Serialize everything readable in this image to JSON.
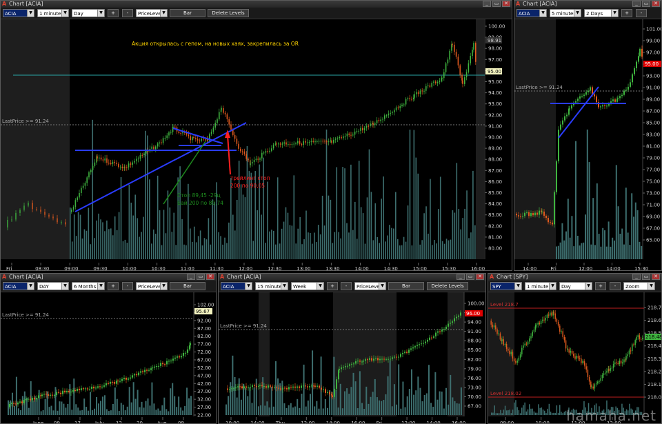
{
  "windows": {
    "w1": {
      "title": "Chart [ACIA]",
      "symbol": "ACIA",
      "interval": "1 minute",
      "range": "Day",
      "plus": "+",
      "minus": "-",
      "pricelevel": "PriceLeve",
      "bar_btn": "Bar",
      "delete_btn": "Delete Levels",
      "lastprice": "LastPrice >= 91.24",
      "yticks": [
        "100.00",
        "99.00",
        "98.00",
        "97.00",
        "96.00",
        "95.00",
        "94.00",
        "93.00",
        "92.00",
        "91.00",
        "90.00",
        "89.00",
        "88.00",
        "87.00",
        "86.00",
        "85.00",
        "84.00",
        "83.00",
        "82.00",
        "81.00",
        "80.00"
      ],
      "tag_top": "98.91",
      "tag_price": "95.00",
      "xticks": [
        "Fri",
        "08:30",
        "09:00",
        "09:30",
        "10:00",
        "10:30",
        "11:00",
        "11:30",
        "12:00",
        "12:30",
        "13:00",
        "13:30",
        "14:00",
        "14:30",
        "15:00",
        "15:30",
        "16:00"
      ],
      "ann_top": "Акция открылась с гепом, на новых хаях, закрепилась за OR",
      "ann_red1": "трейлинг стоп",
      "ann_red2": "200 по 90,05",
      "ann_green1": "Стоп 89,45 -29ц",
      "ann_green2": "Бай 200 по 89,74"
    },
    "w2": {
      "title": "Chart [ACIA]",
      "symbol": "ACIA",
      "interval": "5 minutes",
      "range": "2 Days",
      "plus": "+",
      "minus": "-",
      "lastprice": "LastPrice >= 91.24",
      "yticks": [
        "101.00",
        "99.00",
        "97.00",
        "95.00",
        "93.00",
        "91.00",
        "89.00",
        "87.00",
        "85.00",
        "83.00",
        "81.00",
        "79.00",
        "77.00",
        "75.00",
        "73.00",
        "71.00",
        "69.00",
        "67.00",
        "65.00"
      ],
      "tag_price": "95.00",
      "xticks": [
        "14:00",
        "Fri",
        "12:00",
        "14:00",
        "15:30"
      ]
    },
    "w3": {
      "title": "Chart [ACIA]",
      "symbol": "ACIA",
      "interval": "DAY",
      "range": "6 Months",
      "plus": "+",
      "minus": "-",
      "pricelevel": "PriceLeve",
      "bar_btn": "Bar",
      "lastprice": "LastPrice >= 91.24",
      "yticks": [
        "102.00",
        "97.00",
        "92.00",
        "87.00",
        "82.00",
        "77.00",
        "72.00",
        "67.00",
        "52.00",
        "47.00",
        "42.00",
        "37.00",
        "32.00",
        "27.00",
        "22.00"
      ],
      "tag_price": "95.67",
      "xticks": [
        "June",
        "09",
        "17",
        "July",
        "12",
        "20",
        "Aug",
        "09"
      ]
    },
    "w4": {
      "title": "Chart [ACIA]",
      "symbol": "ACIA",
      "interval": "15 minutes",
      "range": "Week",
      "plus": "+",
      "minus": "-",
      "pricelevel": "PriceLeve",
      "bar_btn": "Bar",
      "delete_btn": "Delete Levels",
      "lastprice": "LastPrice >= 91.24",
      "yticks": [
        "100.00",
        "97.00",
        "94.00",
        "91.00",
        "88.00",
        "85.00",
        "82.00",
        "79.00",
        "76.00",
        "73.00",
        "70.00",
        "67.00"
      ],
      "tag_price": "96.00",
      "xticks": [
        "10:00",
        "14:00",
        "Thu",
        "12:00",
        "14:00",
        "16:00",
        "Fri",
        "12:00",
        "14:00",
        "16:00"
      ]
    },
    "w5": {
      "title": "Chart [SPY]",
      "symbol": "SPY",
      "interval": "1 minute",
      "range": "Day",
      "plus": "+",
      "minus": "-",
      "zoom": "Zoom",
      "level_top": "Level 218.7",
      "level_bot": "Level 218.02",
      "yticks": [
        "218.70",
        "218.60",
        "218.50",
        "218.40",
        "218.30",
        "218.20",
        "218.10",
        "218.00"
      ],
      "tag_price": "218.48",
      "xticks": [
        "09:00",
        "10:00",
        "11:00",
        "12:00"
      ]
    }
  },
  "watermark": "hamaha.net",
  "colors": {
    "up": "#3fb43f",
    "down": "#e05a1e",
    "volume": "#3d6e6e",
    "level": "#2aa6a6",
    "blue": "#2a3cff",
    "red": "#ff2020",
    "green": "#1e8a1e",
    "ann": "#ffd400"
  }
}
